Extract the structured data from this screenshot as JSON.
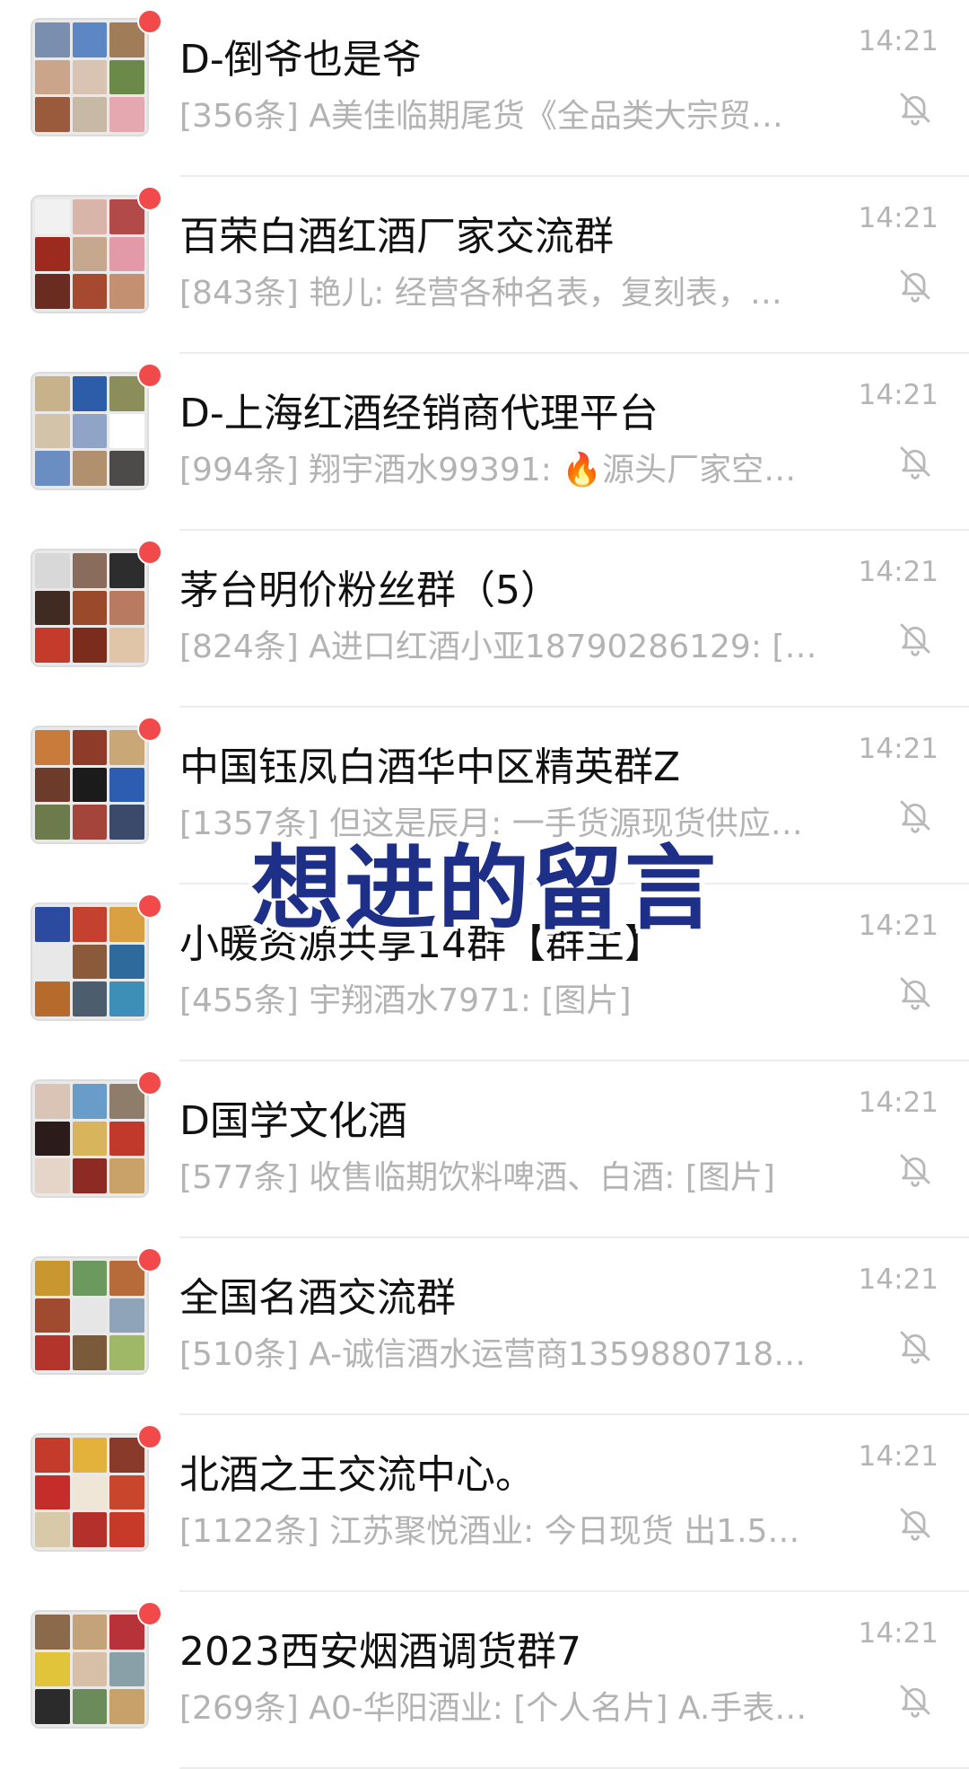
{
  "chats": [
    {
      "title": "D-倒爷也是爷",
      "preview": "[356条] A美佳临期尾货《全品类大宗贸…",
      "time": "14:21",
      "tiles": [
        "#7a8fb0",
        "#5d86c4",
        "#a17c58",
        "#caa58a",
        "#d9c3b3",
        "#6b8a4a",
        "#9a5b3d",
        "#c7b9a6",
        "#e6a8b0"
      ]
    },
    {
      "title": "百荣白酒红酒厂家交流群",
      "preview": "[843条] 艳儿: 经营各种名表，复刻表，…",
      "time": "14:21",
      "tiles": [
        "#f1f1f1",
        "#d8b5a8",
        "#b34a4a",
        "#9c2a1f",
        "#c6a88f",
        "#e39aa8",
        "#6a2c20",
        "#a74830",
        "#c49072"
      ]
    },
    {
      "title": "D-上海红酒经销商代理平台",
      "preview": "[994条] 翔宇酒水99391: 🔥源头厂家空…",
      "time": "14:21",
      "tiles": [
        "#c8b28c",
        "#2d5da8",
        "#8b8d5a",
        "#d3c3a8",
        "#8fa4c7",
        "#ffffff",
        "#6b8ec2",
        "#b19070",
        "#4c4b4a"
      ]
    },
    {
      "title": "茅台明价粉丝群（5）",
      "preview": "[824条] A进口红酒小亚18790286129: […",
      "time": "14:21",
      "tiles": [
        "#d8d8d8",
        "#8a6c5c",
        "#2d2d2d",
        "#3f2b22",
        "#9a4a2a",
        "#b87a60",
        "#c43a2b",
        "#7c2c1c",
        "#e0c5a8"
      ]
    },
    {
      "title": "中国钰凤白酒华中区精英群Z",
      "preview": "[1357条] 但这是辰月: 一手货源现货供应…",
      "time": "14:21",
      "tiles": [
        "#c87b3a",
        "#8e3b2a",
        "#c9a777",
        "#6d3b2a",
        "#1b1b1b",
        "#2c5db0",
        "#6c7a4c",
        "#a5443a",
        "#3b4a6a"
      ]
    },
    {
      "title": "小暖资源共享14群【群主】",
      "preview": "[455条] 宇翔酒水7971: [图片]",
      "time": "14:21",
      "tiles": [
        "#2c4aa0",
        "#c4402f",
        "#d8a040",
        "#e8e8e8",
        "#8a5a3a",
        "#2e6a9c",
        "#b66a2c",
        "#4c5d6e",
        "#3e8fb8"
      ]
    },
    {
      "title": "D国学文化酒",
      "preview": "[577条] 收售临期饮料啤酒、白酒: [图片]",
      "time": "14:21",
      "tiles": [
        "#d9c4b6",
        "#6a9cc9",
        "#8d7d6a",
        "#2b1b1b",
        "#d8b55c",
        "#c0392b",
        "#e5d5c8",
        "#8e2a24",
        "#c9a26a"
      ]
    },
    {
      "title": "全国名酒交流群",
      "preview": "[510条] A-诚信酒水运营商1359880718…",
      "time": "14:21",
      "tiles": [
        "#c9972f",
        "#6c9a5e",
        "#b86b3a",
        "#a04a30",
        "#e6e6e6",
        "#8fa4b8",
        "#b2342a",
        "#7a5a3a",
        "#9fb868"
      ]
    },
    {
      "title": "北酒之王交流中心。",
      "preview": "[1122条] 江苏聚悦酒业: 今日现货 出1.5…",
      "time": "14:21",
      "tiles": [
        "#c43a2b",
        "#e2b23a",
        "#8a3a2a",
        "#c42d2a",
        "#f0e6d8",
        "#c9452c",
        "#d8c9a8",
        "#b4302a",
        "#c73a2a"
      ]
    },
    {
      "title": "2023西安烟酒调货群7",
      "preview": "[269条] A0-华阳酒业: [个人名片] A.手表…",
      "time": "14:21",
      "tiles": [
        "#8a6a4a",
        "#c4a27a",
        "#b8323a",
        "#e2c43a",
        "#d8c0a8",
        "#8aa0a8",
        "#2b2b2b",
        "#6b8c5a",
        "#c7a06a"
      ]
    }
  ],
  "overlay_caption": "想进的留言",
  "colors": {
    "unread_dot": "#f24a4a",
    "caption_text": "#1d2f86",
    "time_text": "#b4b4b4",
    "preview_text": "#b3b3b3"
  },
  "icons": {
    "mute": "bell-slash-icon"
  }
}
